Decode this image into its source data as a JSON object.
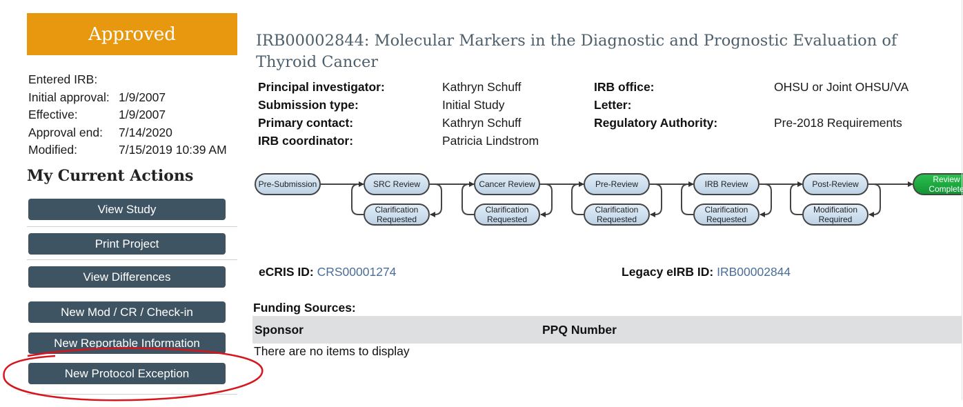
{
  "sidebar": {
    "status": "Approved",
    "status_color": "#e8980f",
    "dates": [
      {
        "label": "Entered IRB:",
        "value": ""
      },
      {
        "label": "Initial approval:",
        "value": "1/9/2007"
      },
      {
        "label": "Effective:",
        "value": "1/9/2007"
      },
      {
        "label": "Approval end:",
        "value": "7/14/2020"
      },
      {
        "label": "Modified:",
        "value": "7/15/2019 10:39 AM"
      }
    ],
    "actions_title": "My Current Actions",
    "actions": [
      {
        "label": "View Study"
      },
      {
        "label": "Print Project"
      },
      {
        "label": "View Differences"
      },
      {
        "label": "New Mod / CR / Check-in"
      },
      {
        "label": "New Reportable Information"
      },
      {
        "label": "New Protocol Exception"
      }
    ],
    "button_color": "#3f5463"
  },
  "main": {
    "title": "IRB00002844: Molecular Markers in the Diagnostic and Prognostic Evaluation of Thyroid Cancer",
    "left_fields": [
      {
        "label": "Principal investigator:",
        "value": "Kathryn Schuff"
      },
      {
        "label": "Submission type:",
        "value": "Initial Study"
      },
      {
        "label": "Primary contact:",
        "value": "Kathryn Schuff"
      },
      {
        "label": "IRB coordinator:",
        "value": "Patricia Lindstrom"
      }
    ],
    "right_fields": [
      {
        "label": "IRB office:",
        "value": "OHSU or Joint OHSU/VA"
      },
      {
        "label": "Letter:",
        "value": ""
      },
      {
        "label": "Regulatory Authority:",
        "value": "Pre-2018 Requirements"
      }
    ],
    "workflow": {
      "stages": [
        "Pre-Submission",
        "SRC Review",
        "Cancer Review",
        "Pre-Review",
        "IRB Review",
        "Post-Review",
        "Review Complete"
      ],
      "loops": [
        "Clarification Requested",
        "Clarification Requested",
        "Clarification Requested",
        "Clarification Requested",
        "Modification Required"
      ],
      "current_stage": "Review Complete",
      "current_color": "#1da540"
    },
    "ecris": {
      "label": "eCRIS ID:",
      "value": "CRS00001274"
    },
    "legacy": {
      "label": "Legacy eIRB ID:",
      "value": "IRB00002844"
    },
    "funding": {
      "label": "Funding Sources:",
      "columns": [
        "Sponsor",
        "PPQ Number"
      ],
      "empty_text": "There are no items to display"
    }
  }
}
